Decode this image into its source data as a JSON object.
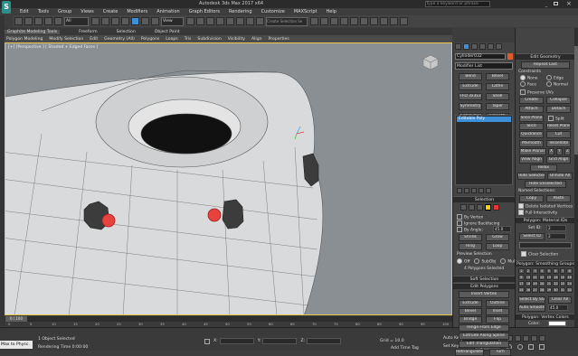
{
  "titlebar": {
    "app_text": "Autodesk 3ds Max 2017 x64",
    "search_placeholder": "Type a keyword or phrase"
  },
  "menu": [
    "Edit",
    "Tools",
    "Group",
    "Views",
    "Create",
    "Modifiers",
    "Animation",
    "Graph Editors",
    "Rendering",
    "Customize",
    "MAXScript",
    "Help"
  ],
  "toolbar": {
    "filter_value": "All",
    "view_value": "View",
    "selection_set_placeholder": "Create Selection Se"
  },
  "ribbon": {
    "tabs": [
      "Graphite Modeling Tools",
      "Freeform",
      "Selection",
      "Object Paint"
    ],
    "tools": [
      "Polygon Modeling",
      "Modify Selection",
      "Edit",
      "Geometry (All)",
      "Polygons",
      "Loops",
      "Tris",
      "Subdivision",
      "Visibility",
      "Align",
      "Properties"
    ]
  },
  "viewport": {
    "label": "[+] [Perspective ] [ Shaded + Edged Faces ]"
  },
  "command_panel": {
    "object_name": "Cylinder032",
    "modifier_list": "Modifier List",
    "modifier_buttons": [
      "Bend",
      "Bevel",
      "Extrude",
      "Lathe",
      "FFD 3x3x3",
      "Shell",
      "Symmetry",
      "Taper",
      "TurboSmooth",
      "Smooth"
    ],
    "stack_item": "Editable Poly",
    "selection": {
      "title": "Selection",
      "by_vertex": "By Vertex",
      "ignore_backfacing": "Ignore Backfacing",
      "by_angle": "By Angle:",
      "by_angle_value": "45.0",
      "shrink": "Shrink",
      "grow": "Grow",
      "ring": "Ring",
      "loop": "Loop",
      "preview_selection": "Preview Selection",
      "off": "Off",
      "subobj": "SubObj",
      "multi": "Multi",
      "status": "4 Polygons Selected"
    },
    "soft_selection": "Soft Selection",
    "edit_polygons": {
      "title": "Edit Polygons",
      "insert_vertex": "Insert Vertex",
      "extrude": "Extrude",
      "outline": "Outline",
      "bevel": "Bevel",
      "inset": "Inset",
      "bridge": "Bridge",
      "flip": "Flip",
      "hinge": "Hinge From Edge",
      "extrude_spline": "Extrude Along Spline",
      "edit_triangulation": "Edit Triangulation",
      "retriangulate": "Retriangulate",
      "turn": "Turn"
    }
  },
  "edit_geometry": {
    "title": "Edit Geometry",
    "repeat_last": "Repeat Last",
    "constraints": "Constraints",
    "none": "None",
    "edge": "Edge",
    "face": "Face",
    "normal": "Normal",
    "preserve_uvs": "Preserve UVs",
    "create": "Create",
    "collapse": "Collapse",
    "attach": "Attach",
    "detach": "Detach",
    "slice_plane": "Slice Plane",
    "split": "Split",
    "slice": "Slice",
    "reset_plane": "Reset Plane",
    "quickslice": "QuickSlice",
    "cut": "Cut",
    "msmooth": "MSmooth",
    "tessellate": "Tessellate",
    "make_planar": "Make Planar",
    "x": "X",
    "y": "Y",
    "z": "Z",
    "view_align": "View Align",
    "grid_align": "Grid Align",
    "relax": "Relax",
    "hide_selected": "Hide Selected",
    "unhide_all": "Unhide All",
    "hide_unselected": "Hide Unselected",
    "named_selections": "Named Selections:",
    "copy": "Copy",
    "paste": "Paste",
    "delete_isolated": "Delete Isolated Vertices",
    "full_interactivity": "Full Interactivity"
  },
  "material_ids": {
    "title": "Polygon: Material IDs",
    "set_id": "Set ID:",
    "set_id_value": "2",
    "select_id": "Select ID",
    "select_id_value": "2",
    "clear_selection": "Clear Selection"
  },
  "smoothing": {
    "title": "Polygon: Smoothing Groups",
    "groups": [
      "1",
      "2",
      "3",
      "4",
      "5",
      "6",
      "7",
      "8",
      "9",
      "10",
      "11",
      "12",
      "13",
      "14",
      "15",
      "16",
      "17",
      "18",
      "19",
      "20",
      "21",
      "22",
      "23",
      "24",
      "25",
      "26",
      "27",
      "28",
      "29",
      "30",
      "31",
      "32"
    ],
    "select_by_sg": "Select By SG",
    "clear_all": "Clear All",
    "auto_smooth": "Auto Smooth",
    "auto_smooth_value": "45.0"
  },
  "vertex_colors": {
    "title": "Polygon: Vertex Colors",
    "color": "Color:"
  },
  "timeline": {
    "frame": "0 / 100",
    "ticks": [
      "0",
      "5",
      "10",
      "15",
      "20",
      "25",
      "30",
      "35",
      "40",
      "45",
      "50",
      "55",
      "60",
      "65",
      "70",
      "75",
      "80",
      "85",
      "90",
      "95",
      "100"
    ]
  },
  "status": {
    "maxscript": "Max to Physc.",
    "selected": "1 Object Selected",
    "rendering": "Rendering Time 0:00:00",
    "x_label": "X:",
    "y_label": "Y:",
    "z_label": "Z:",
    "grid": "Grid = 10.0",
    "add_time_tag": "Add Time Tag",
    "auto_key": "Auto Key",
    "selected_dropdown": "Selected",
    "set_key": "Set Key",
    "key_filters": "Key Filters..."
  },
  "colors": {
    "selection_highlight": "#e8423f",
    "active_blue": "#3d8fd8",
    "background": "#3d3d3d",
    "viewport": "#8a8f94"
  }
}
